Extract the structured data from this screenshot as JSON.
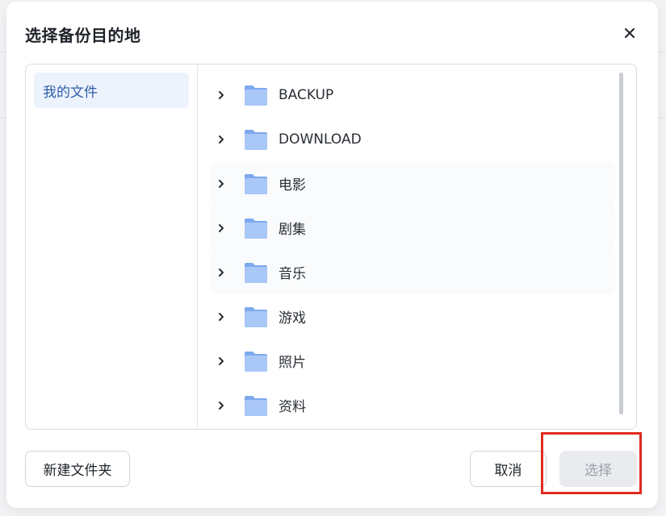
{
  "dialog": {
    "title": "选择备份目的地",
    "close_icon": "close-icon"
  },
  "sidebar": {
    "items": [
      {
        "label": "我的文件",
        "selected": true
      }
    ]
  },
  "folders": [
    {
      "name": "BACKUP"
    },
    {
      "name": "DOWNLOAD"
    },
    {
      "name": "电影"
    },
    {
      "name": "剧集"
    },
    {
      "name": "音乐"
    },
    {
      "name": "游戏"
    },
    {
      "name": "照片"
    },
    {
      "name": "资料"
    }
  ],
  "footer": {
    "new_folder_label": "新建文件夹",
    "cancel_label": "取消",
    "select_label": "选择",
    "select_disabled": true
  },
  "colors": {
    "folder_icon": "#8fb6f4",
    "selected_bg": "#edf3fd",
    "selected_text": "#2f5ea8",
    "highlight_border": "#e02b20"
  }
}
